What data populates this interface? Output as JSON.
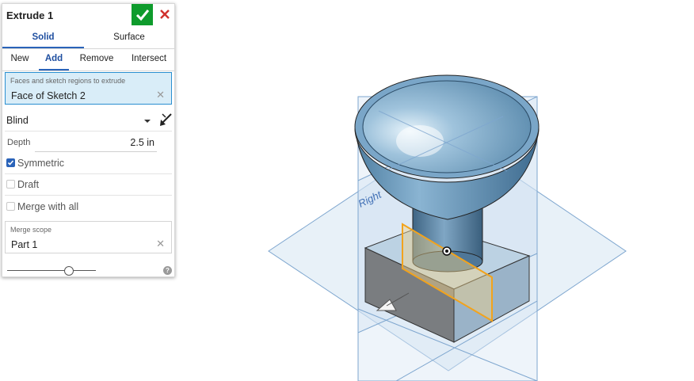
{
  "dialog": {
    "title": "Extrude 1",
    "body_tabs": [
      {
        "label": "Solid",
        "active": true
      },
      {
        "label": "Surface",
        "active": false
      }
    ],
    "op_tabs": [
      {
        "label": "New",
        "active": false
      },
      {
        "label": "Add",
        "active": true
      },
      {
        "label": "Remove",
        "active": false
      },
      {
        "label": "Intersect",
        "active": false
      }
    ],
    "selection": {
      "label": "Faces and sketch regions to extrude",
      "value": "Face of Sketch 2"
    },
    "end_type": "Blind",
    "depth": {
      "label": "Depth",
      "value": "2.5 in"
    },
    "symmetric": {
      "label": "Symmetric",
      "checked": true
    },
    "draft": {
      "label": "Draft",
      "checked": false
    },
    "merge_with_all": {
      "label": "Merge with all",
      "checked": false
    },
    "merge_scope": {
      "label": "Merge scope",
      "value": "Part 1"
    },
    "slider_level": 0.7
  },
  "viewport": {
    "plane_label": "Right",
    "colors": {
      "accent": "#2a63b9",
      "confirm": "#0e9b2c",
      "cancel": "#d0312d",
      "highlight": "#f2a31c",
      "plane": "#c9dcef"
    }
  }
}
